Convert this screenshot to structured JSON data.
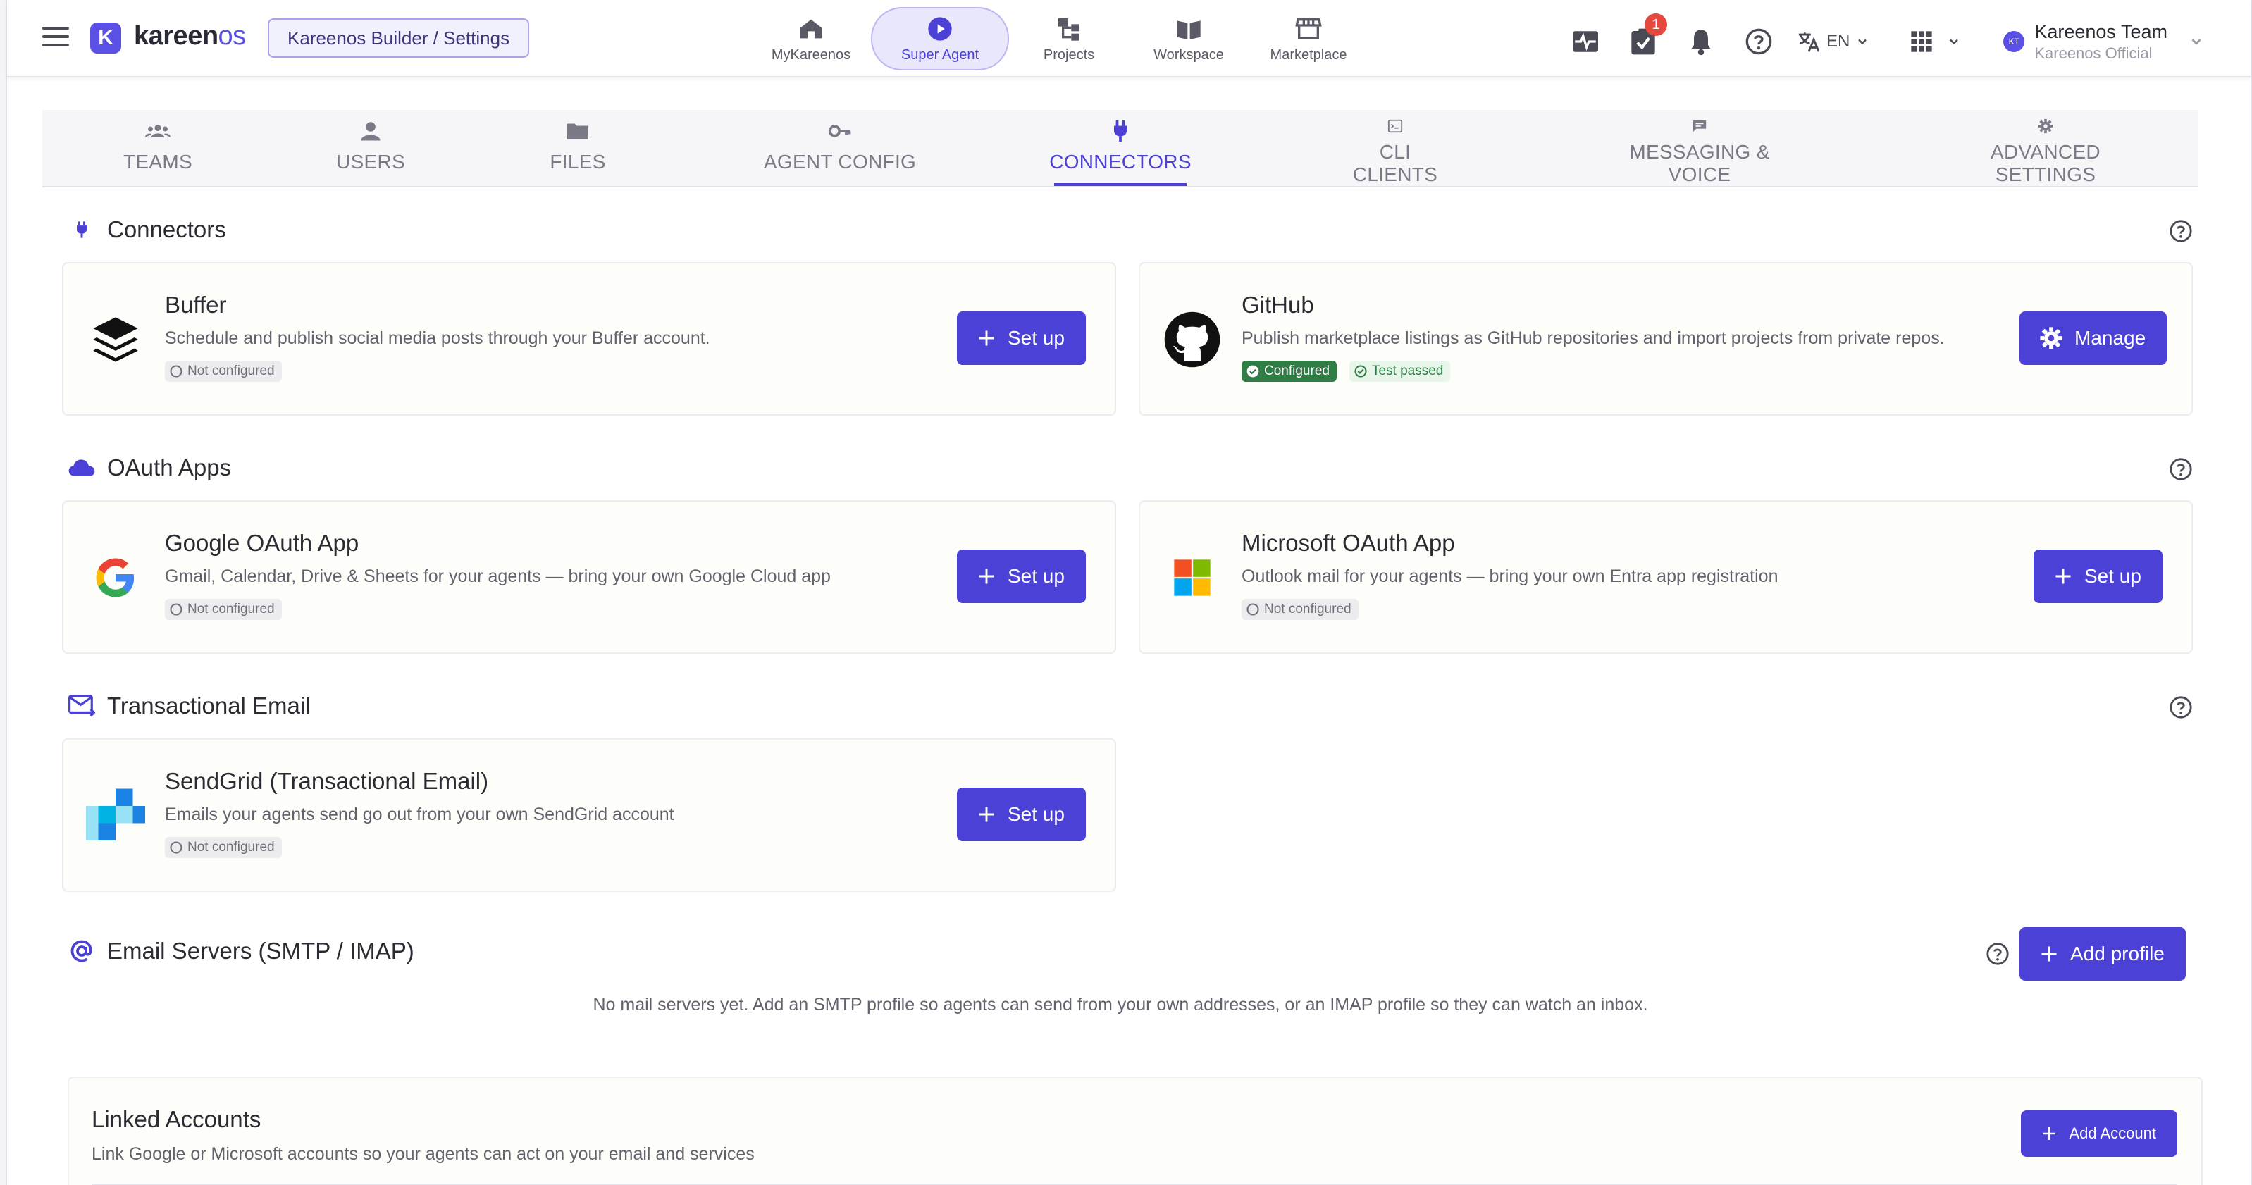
{
  "app": {
    "logo_letter": "K",
    "logo_name": "kareen",
    "logo_suffix": "os",
    "breadcrumb": "Kareenos Builder / Settings"
  },
  "topnav": [
    {
      "label": "MyKareenos",
      "icon": "home-icon"
    },
    {
      "label": "Super Agent",
      "icon": "play-circle-icon",
      "active": true
    },
    {
      "label": "Projects",
      "icon": "hierarchy-icon"
    },
    {
      "label": "Workspace",
      "icon": "book-icon"
    },
    {
      "label": "Marketplace",
      "icon": "store-icon"
    }
  ],
  "toolbar": {
    "tasks_badge": "1",
    "language": "EN"
  },
  "user": {
    "initials": "KT",
    "name": "Kareenos Team",
    "org": "Kareenos Official"
  },
  "tabs": [
    {
      "label": "TEAMS",
      "icon": "team-icon"
    },
    {
      "label": "USERS",
      "icon": "user-icon"
    },
    {
      "label": "FILES",
      "icon": "folder-icon"
    },
    {
      "label": "AGENT CONFIG",
      "icon": "key-icon"
    },
    {
      "label": "CONNECTORS",
      "icon": "plug-icon",
      "active": true
    },
    {
      "label": "CLI CLIENTS",
      "icon": "terminal-icon"
    },
    {
      "label": "MESSAGING & VOICE",
      "icon": "chat-icon"
    },
    {
      "label": "ADVANCED SETTINGS",
      "icon": "gear-icon"
    }
  ],
  "sections": {
    "connectors": "Connectors",
    "oauth": "OAuth Apps",
    "email": "Transactional Email",
    "servers": "Email Servers (SMTP / IMAP)"
  },
  "cards": {
    "buffer": {
      "title": "Buffer",
      "desc": "Schedule and publish social media posts through your Buffer account.",
      "status": "Not configured",
      "action": "Set up"
    },
    "github": {
      "title": "GitHub",
      "desc": "Publish marketplace listings as GitHub repositories and import projects from private repos.",
      "status": "Configured",
      "test": "Test passed",
      "action": "Manage"
    },
    "google": {
      "title": "Google OAuth App",
      "desc": "Gmail, Calendar, Drive & Sheets for your agents — bring your own Google Cloud app",
      "status": "Not configured",
      "action": "Set up"
    },
    "microsoft": {
      "title": "Microsoft OAuth App",
      "desc": "Outlook mail for your agents — bring your own Entra app registration",
      "status": "Not configured",
      "action": "Set up"
    },
    "sendgrid": {
      "title": "SendGrid (Transactional Email)",
      "desc": "Emails your agents send go out from your own SendGrid account",
      "status": "Not configured",
      "action": "Set up"
    }
  },
  "servers": {
    "add_label": "Add profile",
    "empty": "No mail servers yet. Add an SMTP profile so agents can send from your own addresses, or an IMAP profile so they can watch an inbox."
  },
  "linked": {
    "title": "Linked Accounts",
    "desc": "Link Google or Microsoft accounts so your agents can act on your email and services",
    "add_label": "Add Account"
  },
  "colors": {
    "accent": "#4b41d6",
    "brand": "#5b50e6",
    "badge": "#e5483d",
    "configured": "#2f7d45"
  }
}
